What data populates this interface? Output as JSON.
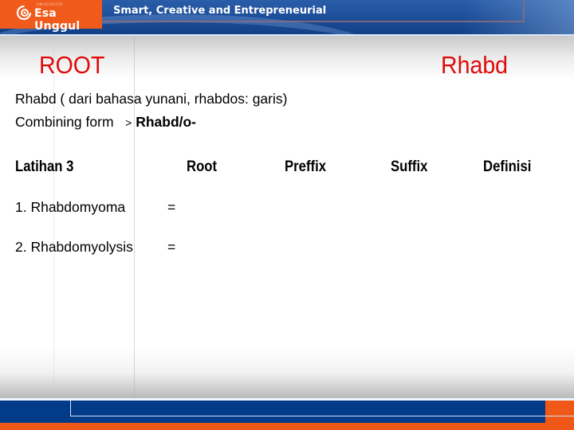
{
  "header": {
    "logo": {
      "icon": "esa-unggul-swirl-logo-icon",
      "superscript": "UNIVERSITAS",
      "name": "Esa Unggul"
    },
    "tagline": "Smart, Creative and Entrepreneurial"
  },
  "slide": {
    "title_left": "ROOT",
    "title_right": "Rhabd",
    "definition_line": "Rhabd ( dari bahasa yunani, rhabdos: garis)",
    "combining_form": {
      "label": "Combining form",
      "arrow": ">",
      "value": "Rhabd/o-"
    },
    "table": {
      "headers": [
        "Latihan 3",
        "Root",
        "Preffix",
        "Suffix",
        "Definisi"
      ],
      "rows": [
        {
          "term": "1. Rhabdomyoma",
          "equals": "="
        },
        {
          "term": "2. Rhabdomyolysis",
          "equals": "="
        }
      ]
    }
  },
  "colors": {
    "brand_orange": "#f05a1a",
    "brand_blue": "#023c88",
    "title_red": "#e00a0a"
  }
}
